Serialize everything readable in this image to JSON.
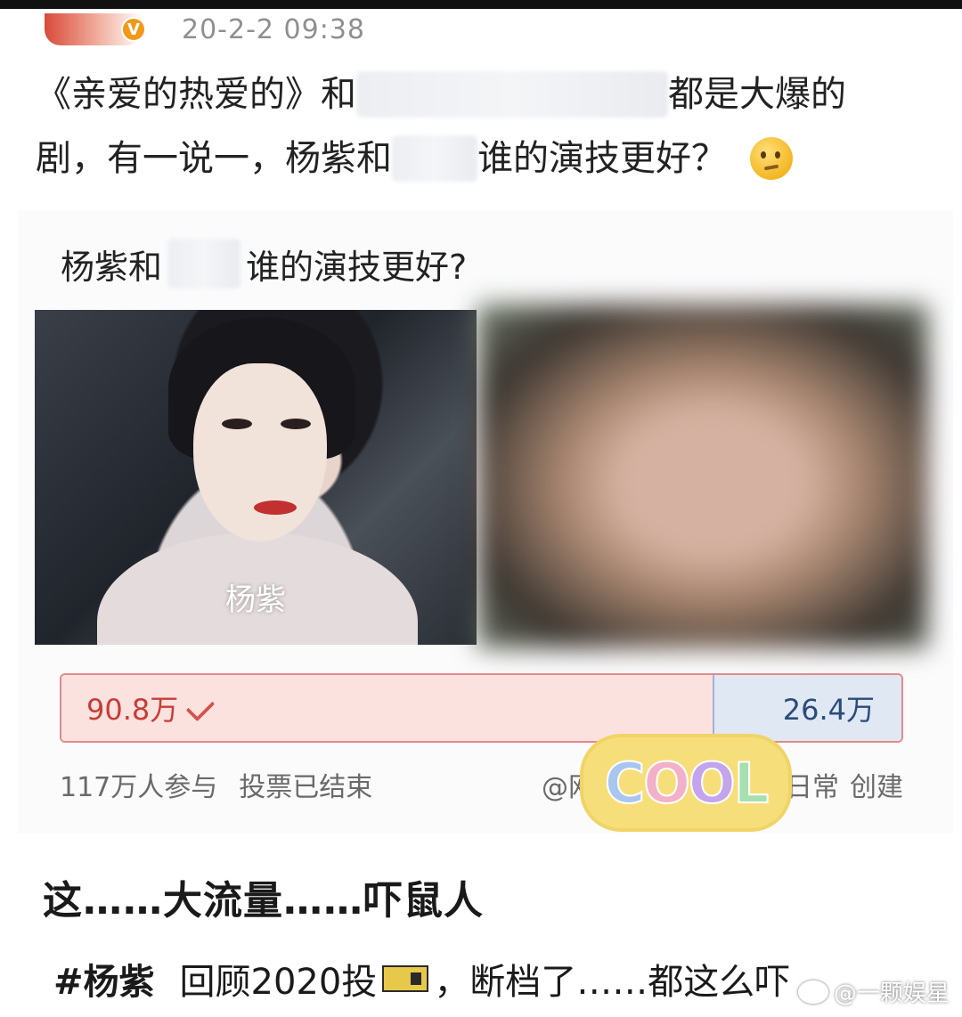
{
  "post": {
    "timestamp": "20-2-2 09:38",
    "text_line1_part1": "《亲爱的热爱的》和",
    "text_line1_part2": "都是大爆的",
    "text_line2_part1": "剧，有一说一，杨紫和",
    "text_line2_part2": "谁的演技更好？"
  },
  "poll": {
    "question_part1": "杨紫和",
    "question_part2": "谁的演技更好?",
    "left_option_label": "杨紫",
    "left_votes": "90.8万",
    "right_votes": "26.4万",
    "left_share": 0.775,
    "participants": "117万人参与",
    "status": "投票已结束",
    "creator_prefix": "@网",
    "creator_suffix": "日常",
    "created_label": "创建"
  },
  "sticker": {
    "text": [
      "C",
      "O",
      "O",
      "L"
    ],
    "colors": [
      "#a8c6ef",
      "#f2b0c9",
      "#c4a4ea",
      "#a6dfb0"
    ]
  },
  "headline": "这……大流量……吓鼠人",
  "bottom": {
    "hashtag": "#杨紫",
    "text_part1": "回顾2020投",
    "text_part2": "，断档了……都这么吓"
  },
  "watermark": "@一颗娱星",
  "colors": {
    "accent_red": "#c73d37",
    "accent_blue": "#2c4b7a"
  }
}
